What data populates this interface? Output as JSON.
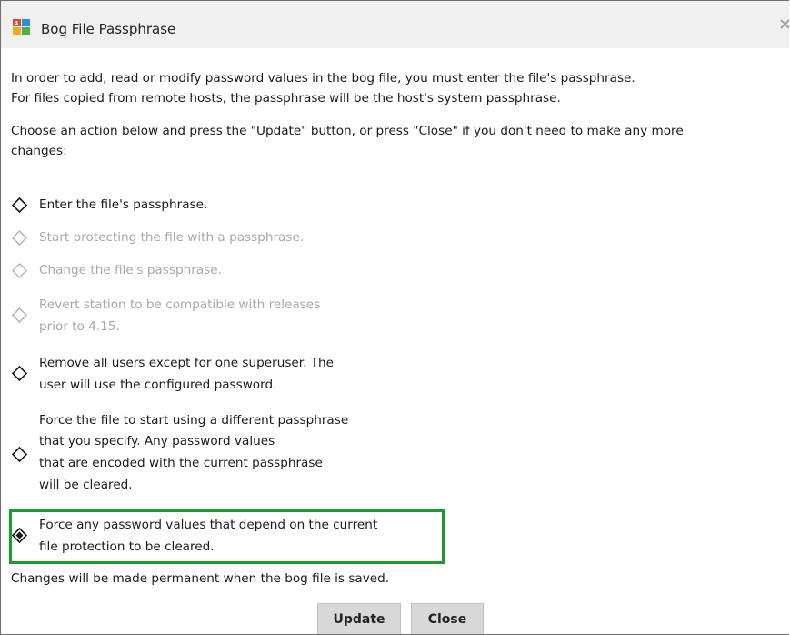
{
  "window": {
    "title": "Bog File Passphrase"
  },
  "intro": {
    "line1": "In order to add, read or modify password values in the bog file, you must enter the file's passphrase.",
    "line2": "For files copied from remote hosts, the passphrase will be the host's system passphrase."
  },
  "instruction": {
    "line1": "Choose an action below and press the \"Update\" button, or press \"Close\" if you don't need to make any more",
    "line2": "changes:"
  },
  "options": [
    {
      "lines": [
        "Enter the file's passphrase."
      ],
      "enabled": true,
      "selected": false
    },
    {
      "lines": [
        "Start protecting the file with a passphrase."
      ],
      "enabled": false,
      "selected": false
    },
    {
      "lines": [
        "Change the file's passphrase."
      ],
      "enabled": false,
      "selected": false
    },
    {
      "lines": [
        "Revert station to be compatible with releases",
        "prior to 4.15."
      ],
      "enabled": false,
      "selected": false
    },
    {
      "lines": [
        "Remove all users except for one superuser. The",
        "user will use the configured password."
      ],
      "enabled": true,
      "selected": false
    },
    {
      "lines": [
        "Force the file to start using a different passphrase",
        "that you specify. Any password values",
        "that are encoded with the current passphrase",
        "will be cleared."
      ],
      "enabled": true,
      "selected": false
    },
    {
      "lines": [
        "Force any password values that depend on the current",
        "file protection to be cleared."
      ],
      "enabled": true,
      "selected": true
    }
  ],
  "footer_note": "Changes will be made permanent when the bog file is saved.",
  "buttons": {
    "update": "Update",
    "close": "Close"
  },
  "colors": {
    "highlight": "#1e9a2e",
    "disabled_text": "#a8a8a8"
  }
}
